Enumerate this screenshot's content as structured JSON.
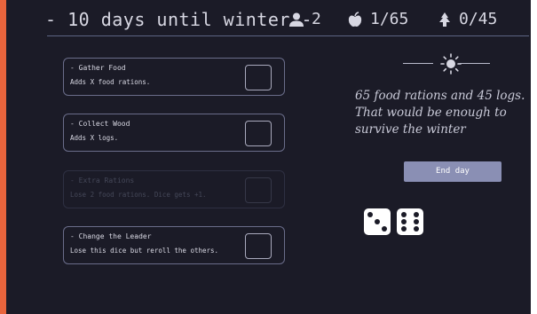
{
  "header": {
    "title": "- 10 days until winter -",
    "people": {
      "icon": "person-icon",
      "count": "2"
    },
    "food": {
      "icon": "apple-icon",
      "value": "1/65"
    },
    "wood": {
      "icon": "tree-icon",
      "value": "0/45"
    }
  },
  "actions": [
    {
      "title": "- Gather Food",
      "description": "Adds X food rations.",
      "enabled": true
    },
    {
      "title": "- Collect Wood",
      "description": "Adds X logs.",
      "enabled": true
    },
    {
      "title": "- Extra Rations",
      "description": "Lose 2 food rations. Dice gets +1.",
      "enabled": false
    },
    {
      "title": "- Change the Leader",
      "description": "Lose this dice but reroll the others.",
      "enabled": true
    }
  ],
  "weather": {
    "icon": "sun-icon"
  },
  "message": "65 food rations and 45 logs. That would be enough to survive the winter",
  "end_day_label": "End day",
  "dice": [
    {
      "face": 3
    },
    {
      "face": 6
    }
  ],
  "colors": {
    "background": "#1b1b27",
    "accent_bar": "#e8643c",
    "button": "#8a8fb4",
    "text": "#d7d7e2"
  }
}
